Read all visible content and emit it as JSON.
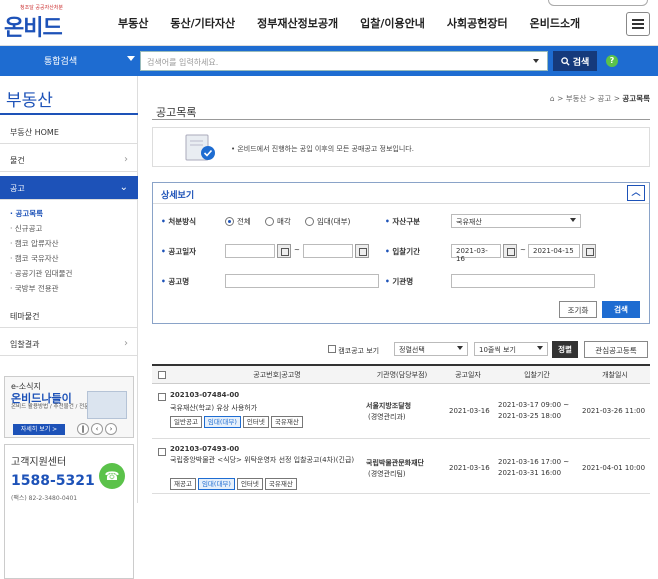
{
  "header": {
    "logo_tagline": "청조달 공공자산처분",
    "logo_name": "온비드",
    "nav": [
      "부동산",
      "동산/기타자산",
      "정부재산정보공개",
      "입찰/이용안내",
      "사회공헌장터",
      "온비드소개"
    ]
  },
  "search": {
    "scope": "통합검색",
    "placeholder": "검색어를 입력하세요.",
    "button": "검색",
    "help": "?"
  },
  "sidebar": {
    "title": "부동산",
    "items": [
      {
        "label": "부동산 HOME",
        "chevron": ""
      },
      {
        "label": "물건",
        "chevron": "›"
      },
      {
        "label": "공고",
        "chevron": "⌄"
      }
    ],
    "subitems": [
      "공고목록",
      "신규공고",
      "캠코 압류자산",
      "캠코 국유자산",
      "공공기관 임대물건",
      "국방부 전용관"
    ],
    "items2": [
      {
        "label": "테마물건",
        "chevron": ""
      },
      {
        "label": "입찰결과",
        "chevron": "›"
      }
    ],
    "banner": {
      "line1": "e-소식지",
      "line2": "온비드나들이",
      "line3": "온비드 활용방법 / 추천물건 / 전문가 칼럼 등",
      "button": "자세히 보기 >"
    },
    "cs": {
      "title": "고객지원센터",
      "phone": "1588-5321",
      "fax": "(팩스) 82-2-3480-0401"
    }
  },
  "page": {
    "title": "공고목록",
    "breadcrumb": [
      "부동산",
      "공고",
      "공고목록"
    ],
    "info_text": "• 온비드에서 진행하는 공입 이후의 모든 공매공고 정보입니다."
  },
  "detail": {
    "header": "상세보기",
    "labels": {
      "method": "처분방식",
      "asset": "자산구분",
      "date": "공고일자",
      "period": "입찰기간",
      "name": "공고명",
      "org": "기관명"
    },
    "radios": [
      "전체",
      "매각",
      "임대(대부)"
    ],
    "asset_value": "국유재산",
    "date_sep": "~",
    "period_from": "2021-03-16",
    "period_to": "2021-04-15",
    "reset": "조기화",
    "submit": "검색"
  },
  "tools": {
    "camco_label": "캠코공고 보기",
    "sort": "정렬선택",
    "per_page": "10줄씩 보기",
    "sort_btn": "정렬",
    "register_btn": "관심공고등록"
  },
  "table": {
    "headers": [
      "공고번호|공고명",
      "기관명(담당부점)",
      "공고일자",
      "입찰기간",
      "개찰일시"
    ],
    "rows": [
      {
        "number": "202103-07484-00",
        "name": "국유재산(학교) 유상 사용허가",
        "tags": [
          "일반공고",
          "임대(대부)",
          "인터넷",
          "국유재산"
        ],
        "org": "서울지방조달청",
        "org_sub": "(경영관리과)",
        "date": "2021-03-16",
        "period_from": "2021-03-17 09:00 ~",
        "period_to": "2021-03-25 18:00",
        "open": "2021-03-26 11:00"
      },
      {
        "number": "202103-07493-00",
        "name": "국립중앙박물관 <식당> 위탁운영자 선정 입찰공고(4차)(긴급)",
        "tags": [
          "재공고",
          "임대(대부)",
          "인터넷",
          "국유재산"
        ],
        "org": "국립박물관문화재단",
        "org_sub": "(경영관리팀)",
        "date": "2021-03-16",
        "period_from": "2021-03-16 17:00 ~",
        "period_to": "2021-03-31 16:00",
        "open": "2021-04-01 10:00"
      }
    ]
  }
}
